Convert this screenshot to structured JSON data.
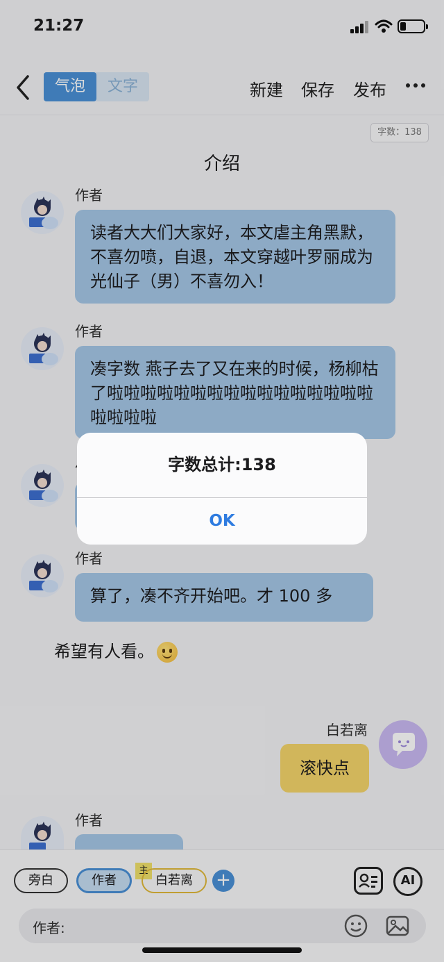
{
  "status_bar": {
    "time": "21:27"
  },
  "nav": {
    "tabs": [
      {
        "label": "气泡",
        "active": true
      },
      {
        "label": "文字",
        "active": false
      }
    ],
    "actions": {
      "new": "新建",
      "save": "保存",
      "publish": "发布"
    }
  },
  "chat": {
    "word_count_badge": "字数：138",
    "section_title": "介绍",
    "messages": [
      {
        "sender": "作者",
        "text": "读者大大们大家好，本文虐主角黑默，不喜勿喷，自退，本文穿越叶罗丽成为光仙子（男）不喜勿入！"
      },
      {
        "sender": "作者",
        "text": "凑字数 燕子去了又在来的时候，杨柳枯了啦啦啦啦啦啦啦啦啦啦啦啦啦啦啦啦啦啦啦啦"
      },
      {
        "sender": "作者",
        "text": ""
      },
      {
        "sender": "作者",
        "text": "算了，凑不齐开始吧。才 100 多"
      },
      {
        "sender": "作者",
        "text": ""
      }
    ],
    "narration": "希望有人看。",
    "narration_emoji": "slightly-smiling-face",
    "right_message": {
      "sender": "白若离",
      "text": "滚快点"
    }
  },
  "alert": {
    "message": "字数总计:138",
    "button": "OK"
  },
  "bottom": {
    "roles": {
      "aside": "旁白",
      "author": "作者",
      "character": "白若离",
      "main_tag": "主"
    },
    "tools": {
      "ai": "AI"
    },
    "input_prefix": "作者:"
  },
  "colors": {
    "accent": "#4a90d6",
    "left_bubble": "#a5c6e6",
    "right_bubble": "#f4d46b",
    "alert_button": "#2f7ce0"
  }
}
